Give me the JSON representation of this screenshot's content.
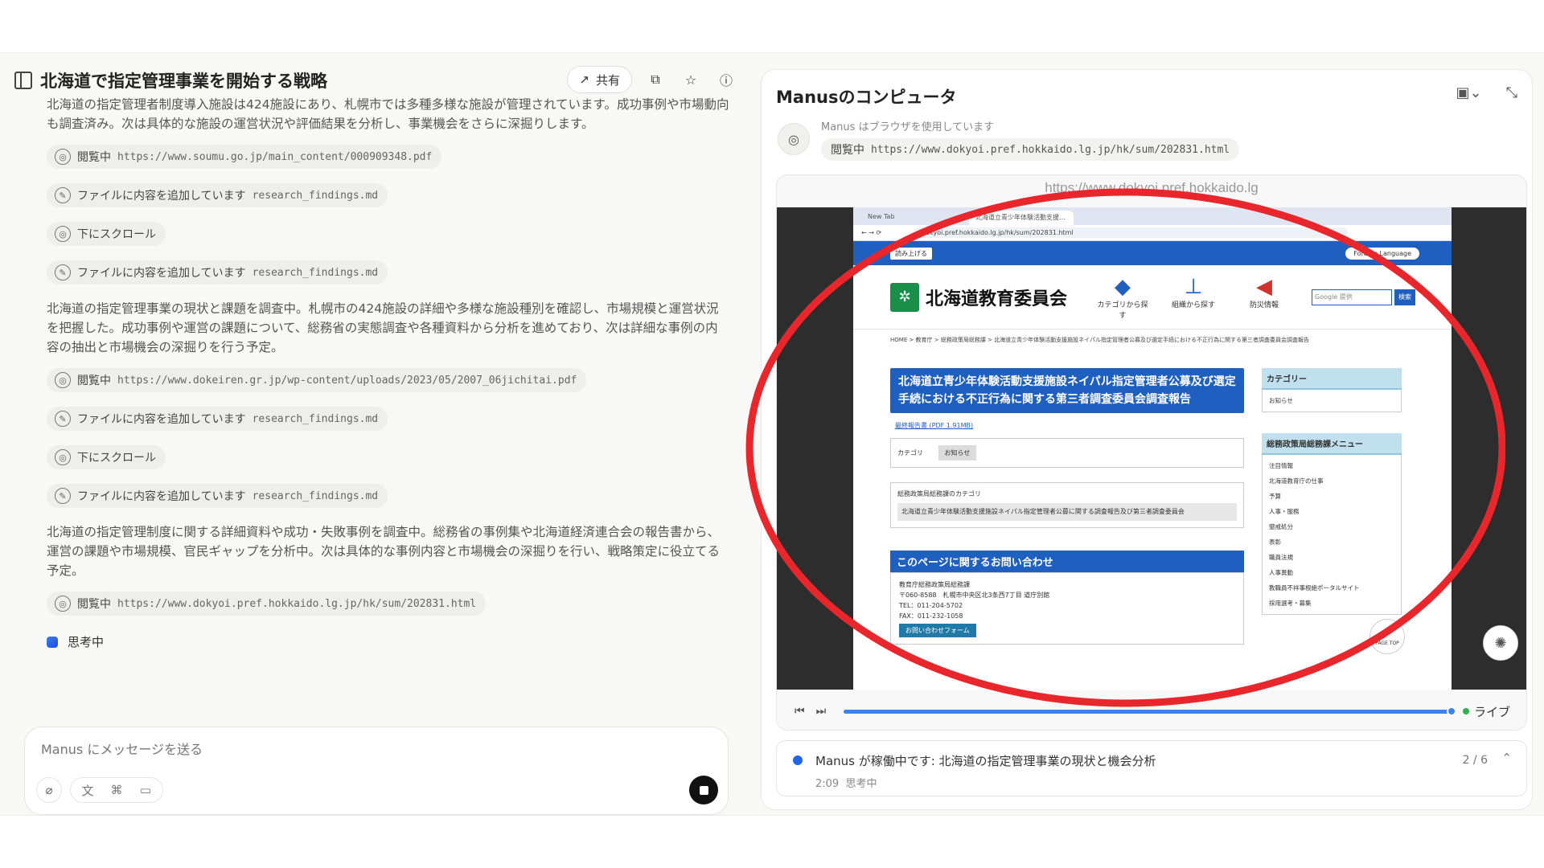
{
  "left": {
    "title": "北海道で指定管理事業を開始する戦略",
    "share_label": "共有",
    "messages": [
      "北海道の指定管理者制度導入施設は424施設にあり、札幌市では多種多様な施設が管理されています。成功事例や市場動向も調査済み。次は具体的な施設の運営状況や評価結果を分析し、事業機会をさらに深掘りします。",
      "北海道の指定管理事業の現状と課題を調査中。札幌市の424施設の詳細や多様な施設種別を確認し、市場規模と運営状況を把握した。成功事例や運営の課題について、総務省の実態調査や各種資料から分析を進めており、次は詳細な事例の内容の抽出と市場機会の深掘りを行う予定。",
      "北海道の指定管理制度に関する詳細資料や成功・失敗事例を調査中。総務省の事例集や北海道経済連合会の報告書から、運営の課題や市場規模、官民ギャップを分析中。次は具体的な事例内容と市場機会の深掘りを行い、戦略策定に役立てる予定。"
    ],
    "steps": [
      {
        "label": "閲覧中",
        "detail": "https://www.soumu.go.jp/main_content/000909348.pdf"
      },
      {
        "label": "ファイルに内容を追加しています",
        "detail": "research_findings.md"
      },
      {
        "label": "下にスクロール",
        "detail": ""
      },
      {
        "label": "ファイルに内容を追加しています",
        "detail": "research_findings.md"
      },
      {
        "label": "閲覧中",
        "detail": "https://www.dokeiren.gr.jp/wp-content/uploads/2023/05/2007_06jichitai.pdf"
      },
      {
        "label": "ファイルに内容を追加しています",
        "detail": "research_findings.md"
      },
      {
        "label": "下にスクロール",
        "detail": ""
      },
      {
        "label": "ファイルに内容を追加しています",
        "detail": "research_findings.md"
      },
      {
        "label": "閲覧中",
        "detail": "https://www.dokyoi.pref.hokkaido.lg.jp/hk/sum/202831.html"
      }
    ],
    "thinking": "思考中",
    "composer_placeholder": "Manus にメッセージを送る"
  },
  "right": {
    "title": "Manusのコンピュータ",
    "agent_sub": "Manus はブラウザを使用しています",
    "browse_label": "閲覧中",
    "browse_url": "https://www.dokyoi.pref.hokkaido.lg.jp/hk/sum/202831.html",
    "viewer_url": "https://www.dokyoi.pref.hokkaido.lg",
    "browser": {
      "tab1": "New Tab",
      "tab2": "北海道立青少年体験活動支援…",
      "address": "dokyoi.pref.hokkaido.lg.jp/hk/sum/202831.html",
      "read_aloud": "読み上げる",
      "foreign": "Foreign Language",
      "site_name": "北海道教育委員会",
      "nav": [
        "カテゴリから探す",
        "組織から探す",
        "防災情報"
      ],
      "search_placeholder": "Google 提供",
      "search_btn": "検索",
      "breadcrumb": "HOME > 教育庁 > 総務政策局総務課 > 北海道立青少年体験活動支援施設ネイパル指定管理者公募及び選定手続における不正行為に関する第三者調査委員会調査報告",
      "heading": "北海道立青少年体験活動支援施設ネイパル指定管理者公募及び選定手続における不正行為に関する第三者調査委員会調査報告",
      "pdf_link": "最終報告書 (PDF 1.91MB)",
      "category_label": "カテゴリ",
      "category_tag": "お知らせ",
      "dept_category": "総務政策局総務課のカテゴリ",
      "dept_item": "北海道立青少年体験活動支援施設ネイパル指定管理者公募に関する調査報告及び第三者調査委員会",
      "contact_title": "このページに関するお問い合わせ",
      "contact_lines": [
        "教育庁総務政策局総務課",
        "〒060-8588　札幌市中央区北3条西7丁目 道庁別館",
        "TEL：011-204-5702",
        "FAX：011-232-1058"
      ],
      "contact_btn": "お問い合わせフォーム",
      "side_cat_title": "カテゴリー",
      "side_cat_item": "お知らせ",
      "side_menu_title": "総務政策局総務課メニュー",
      "side_menu": [
        "注目情報",
        "北海道教育庁の仕事",
        "予算",
        "人事・服務",
        "懲戒処分",
        "表彰",
        "職員法規",
        "人事異動",
        "教職員不祥事根絶ポータルサイト",
        "採用選考・募集"
      ],
      "page_top": "PAGE TOP"
    },
    "live_label": "ライブ",
    "status_text": "Manus が稼働中です: 北海道の指定管理事業の現状と機会分析",
    "status_time": "2:09",
    "status_sub": "思考中",
    "status_count": "2 / 6"
  },
  "colors": {
    "accent": "#3b82f6",
    "annotation": "#e8262b",
    "site_blue": "#1f5fbf"
  }
}
